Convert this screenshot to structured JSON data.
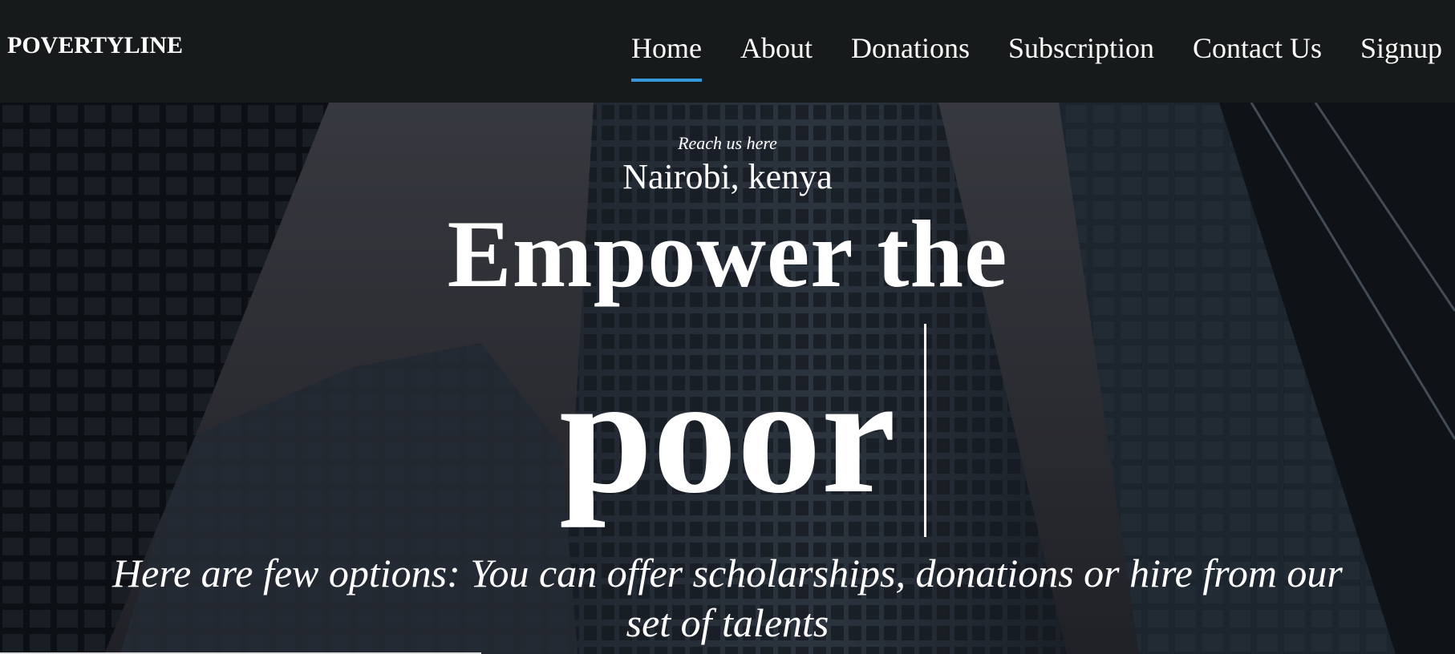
{
  "brand": {
    "name": "POVERTYLINE"
  },
  "nav": {
    "items": [
      {
        "label": "Home",
        "active": true
      },
      {
        "label": "About",
        "active": false
      },
      {
        "label": "Donations",
        "active": false
      },
      {
        "label": "Subscription",
        "active": false
      },
      {
        "label": "Contact Us",
        "active": false
      },
      {
        "label": "Signup",
        "active": false
      }
    ],
    "active_underline_color": "#3498db"
  },
  "hero": {
    "reach_label": "Reach us here",
    "location": "Nairobi, kenya",
    "headline_line1": "Empower the",
    "headline_line2": "poor",
    "tagline": "Here are few options: You can offer scholarships, donations or hire from our set of talents",
    "background": "dark skyscrapers photo"
  },
  "colors": {
    "navbar_bg": "#171a1b",
    "text": "#ffffff",
    "accent": "#3498db"
  }
}
